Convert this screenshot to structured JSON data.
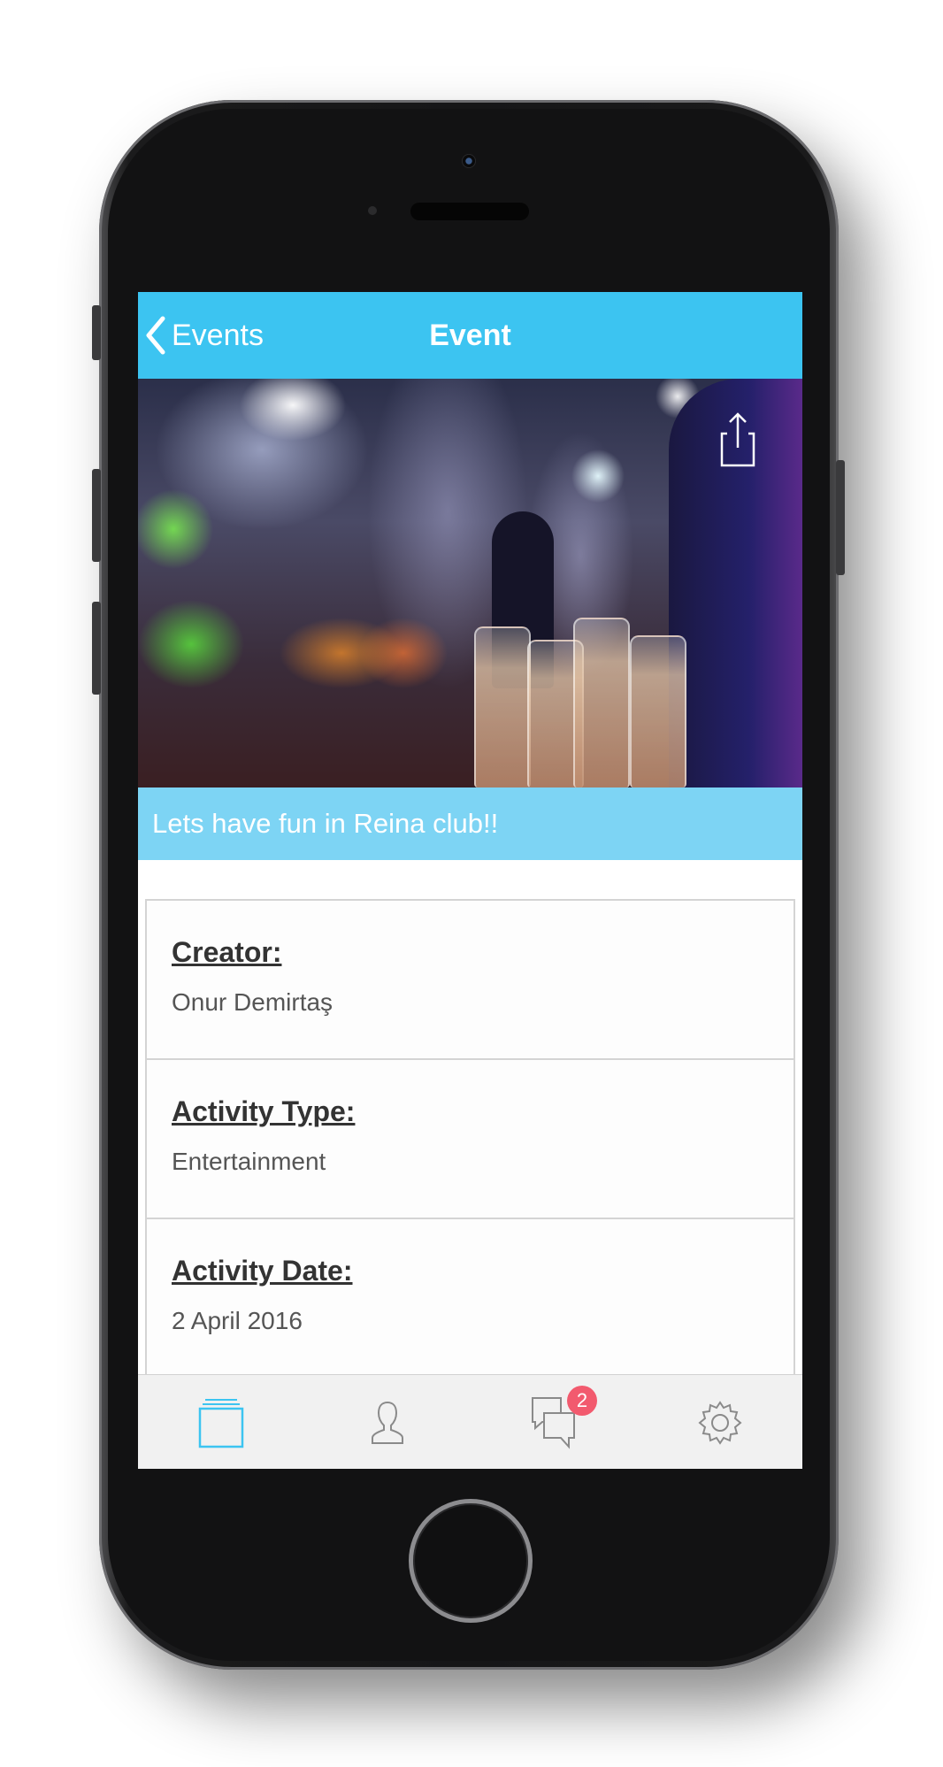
{
  "navbar": {
    "back_label": "Events",
    "title": "Event"
  },
  "event": {
    "title": "Lets have fun in Reina club!!",
    "details": [
      {
        "label": "Creator:",
        "value": "Onur Demirtaş"
      },
      {
        "label": "Activity Type:",
        "value": "Entertainment"
      },
      {
        "label": "Activity Date:",
        "value": "2 April 2016"
      }
    ]
  },
  "tabbar": {
    "tabs": [
      {
        "name": "events",
        "icon": "stack-icon"
      },
      {
        "name": "profile",
        "icon": "person-icon"
      },
      {
        "name": "messages",
        "icon": "chat-icon",
        "badge": "2"
      },
      {
        "name": "settings",
        "icon": "gear-icon"
      }
    ]
  },
  "colors": {
    "navbar": "#3cc4f1",
    "title_bar": "#7dd4f4",
    "active_tab": "#3cc4f1",
    "badge": "#f25a6e"
  }
}
